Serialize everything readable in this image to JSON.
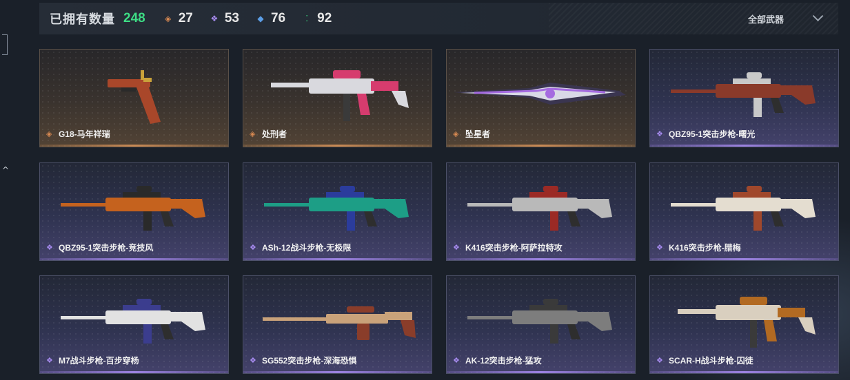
{
  "header": {
    "owned_label": "已拥有数量",
    "owned_count": "248",
    "stats": [
      {
        "icon": "orange-diamond-icon",
        "glyph": "◈",
        "color": "#d98a52",
        "value": "27"
      },
      {
        "icon": "purple-diamond-icon",
        "glyph": "❖",
        "color": "#a78bf0",
        "value": "53"
      },
      {
        "icon": "blue-diamond-icon",
        "glyph": "◆",
        "color": "#5c9ee6",
        "value": "76"
      },
      {
        "icon": "green-dots-icon",
        "glyph": "⁚",
        "color": "#3ddc84",
        "value": "92"
      }
    ],
    "filter_label": "全部武器"
  },
  "weapons": [
    {
      "name": "G18-马年祥瑞",
      "rarity": "gold",
      "glyph": "◈",
      "kind": "pistol",
      "c1": "#a9472a",
      "c2": "#c9a23a"
    },
    {
      "name": "处刑者",
      "rarity": "gold",
      "glyph": "◈",
      "kind": "smg",
      "c1": "#d9d9de",
      "c2": "#d63c6e"
    },
    {
      "name": "坠星者",
      "rarity": "gold",
      "glyph": "◈",
      "kind": "blade",
      "c1": "#3a3550",
      "c2": "#a56be0"
    },
    {
      "name": "QBZ95-1突击步枪-曙光",
      "rarity": "purple",
      "glyph": "❖",
      "kind": "rifle",
      "c1": "#8a3a2a",
      "c2": "#c9c9c9"
    },
    {
      "name": "QBZ95-1突击步枪-竞技风",
      "rarity": "purple",
      "glyph": "❖",
      "kind": "rifle",
      "c1": "#c5621e",
      "c2": "#2a2a2a"
    },
    {
      "name": "ASh-12战斗步枪-无极限",
      "rarity": "purple",
      "glyph": "❖",
      "kind": "rifle",
      "c1": "#1d9e86",
      "c2": "#2b3c9c"
    },
    {
      "name": "K416突击步枪-阿萨拉特攻",
      "rarity": "purple",
      "glyph": "❖",
      "kind": "rifle",
      "c1": "#b9b9b9",
      "c2": "#9b2a25"
    },
    {
      "name": "K416突击步枪-腊梅",
      "rarity": "purple",
      "glyph": "❖",
      "kind": "rifle",
      "c1": "#e4ddd0",
      "c2": "#a0482c"
    },
    {
      "name": "M7战斗步枪-百步穿杨",
      "rarity": "purple",
      "glyph": "❖",
      "kind": "rifle",
      "c1": "#e2e2e2",
      "c2": "#3b3d8e"
    },
    {
      "name": "SG552突击步枪-深海恐惧",
      "rarity": "purple",
      "glyph": "❖",
      "kind": "sniper",
      "c1": "#c9a27a",
      "c2": "#8a3d2a"
    },
    {
      "name": "AK-12突击步枪-猛攻",
      "rarity": "purple",
      "glyph": "❖",
      "kind": "rifle",
      "c1": "#7d7d7d",
      "c2": "#3a3a3a"
    },
    {
      "name": "SCAR-H战斗步枪-囚徒",
      "rarity": "purple",
      "glyph": "❖",
      "kind": "smg",
      "c1": "#d9cfbf",
      "c2": "#b26a22"
    }
  ]
}
